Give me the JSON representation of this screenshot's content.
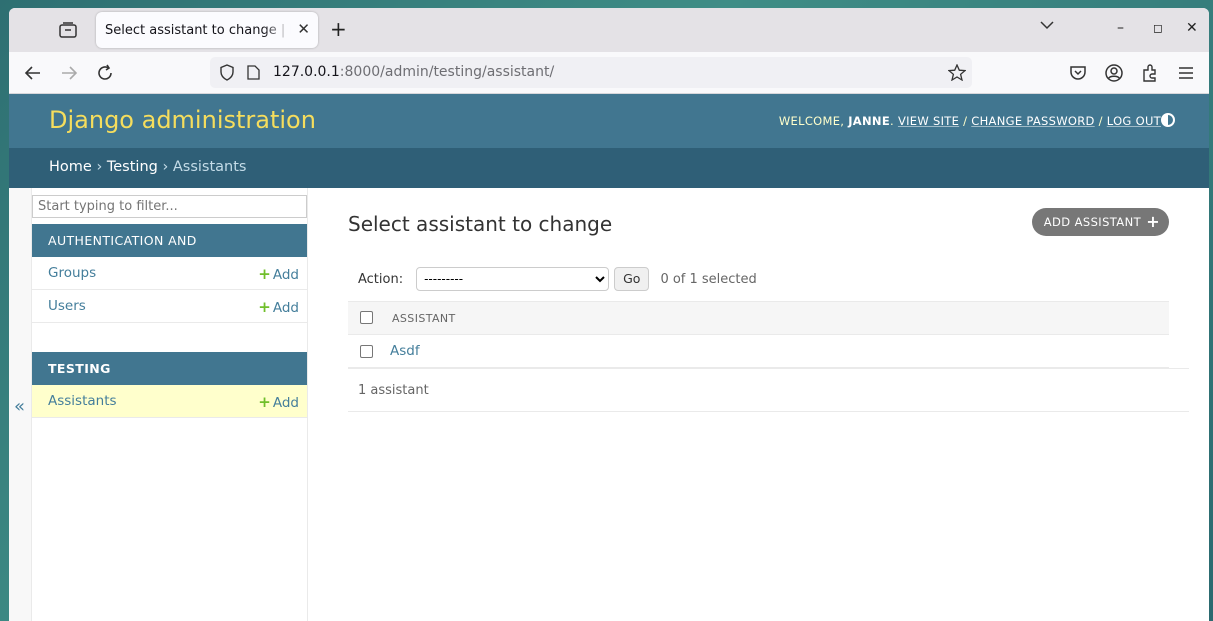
{
  "browser": {
    "tab_title": "Select assistant to change | Django site admin",
    "url_host": "127.0.0.1",
    "url_rest": ":8000/admin/testing/assistant/"
  },
  "header": {
    "branding": "Django administration",
    "welcome": "WELCOME,",
    "username": "JANNE",
    "view_site": "VIEW SITE",
    "change_password": "CHANGE PASSWORD",
    "log_out": "LOG OUT"
  },
  "breadcrumbs": {
    "home": "Home",
    "app": "Testing",
    "current": "Assistants",
    "sep": "›"
  },
  "sidebar": {
    "filter_placeholder": "Start typing to filter...",
    "toggle": "«",
    "modules": [
      {
        "caption": "AUTHENTICATION AND AUTHORIZATION",
        "items": [
          {
            "label": "Groups",
            "add": "Add"
          },
          {
            "label": "Users",
            "add": "Add"
          }
        ]
      },
      {
        "caption": "TESTING",
        "items": [
          {
            "label": "Assistants",
            "add": "Add"
          }
        ]
      }
    ]
  },
  "content": {
    "title": "Select assistant to change",
    "add_button": "ADD ASSISTANT",
    "action_label": "Action:",
    "action_selected": "---------",
    "go_label": "Go",
    "selection_counter": "0 of 1 selected",
    "column_header": "ASSISTANT",
    "rows": [
      "Asdf"
    ],
    "paginator": "1 assistant"
  },
  "colors": {
    "header": "#417690",
    "breadcrumbs": "#2f5f77",
    "branding": "#f5dd5d",
    "link": "#447e9b",
    "current_row": "#ffffcc",
    "add_plus": "#70bf2b"
  }
}
